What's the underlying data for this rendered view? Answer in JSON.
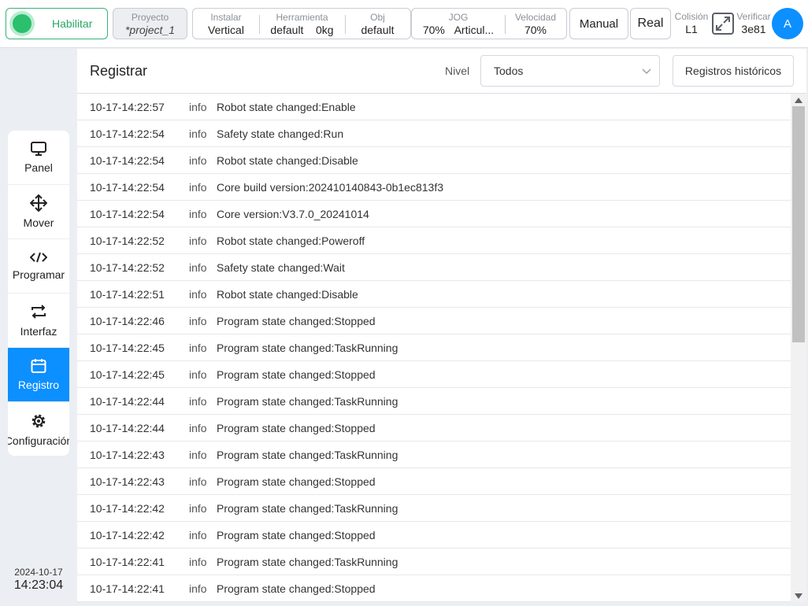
{
  "topbar": {
    "enable_label": "Habilitar",
    "project": {
      "caption": "Proyecto",
      "value": "*project_1"
    },
    "install": {
      "caption": "Instalar",
      "value": "Vertical"
    },
    "tool": {
      "caption": "Herramienta",
      "value": "default",
      "weight": "0kg"
    },
    "obj": {
      "caption": "Obj",
      "value": "default"
    },
    "jog": {
      "caption": "JOG",
      "value": "70%",
      "mode": "Articul..."
    },
    "speed": {
      "caption": "Velocidad",
      "value": "70%"
    },
    "manual_label": "Manual",
    "real_label": "Real",
    "collision": {
      "caption": "Colisión",
      "value": "L1"
    },
    "verify": {
      "caption": "Verificar",
      "value": "3e81"
    },
    "avatar_letter": "A"
  },
  "sidebar": {
    "items": [
      {
        "label": "Panel",
        "icon": "monitor-icon"
      },
      {
        "label": "Mover",
        "icon": "move-arrows-icon"
      },
      {
        "label": "Programar",
        "icon": "code-icon"
      },
      {
        "label": "Interfaz",
        "icon": "swap-icon"
      },
      {
        "label": "Registro",
        "icon": "calendar-icon",
        "active": true
      },
      {
        "label": "Configuración",
        "icon": "gear-icon"
      }
    ],
    "date": "2024-10-17",
    "time": "14:23:04"
  },
  "panel": {
    "title": "Registrar",
    "level_label": "Nivel",
    "level_value": "Todos",
    "history_button": "Registros históricos"
  },
  "log": {
    "rows": [
      {
        "time": "10-17-14:22:57",
        "level": "info",
        "message": "Robot state changed:Enable"
      },
      {
        "time": "10-17-14:22:54",
        "level": "info",
        "message": "Safety state changed:Run"
      },
      {
        "time": "10-17-14:22:54",
        "level": "info",
        "message": "Robot state changed:Disable"
      },
      {
        "time": "10-17-14:22:54",
        "level": "info",
        "message": "Core build version:202410140843-0b1ec813f3"
      },
      {
        "time": "10-17-14:22:54",
        "level": "info",
        "message": "Core version:V3.7.0_20241014"
      },
      {
        "time": "10-17-14:22:52",
        "level": "info",
        "message": "Robot state changed:Poweroff"
      },
      {
        "time": "10-17-14:22:52",
        "level": "info",
        "message": "Safety state changed:Wait"
      },
      {
        "time": "10-17-14:22:51",
        "level": "info",
        "message": "Robot state changed:Disable"
      },
      {
        "time": "10-17-14:22:46",
        "level": "info",
        "message": "Program state changed:Stopped"
      },
      {
        "time": "10-17-14:22:45",
        "level": "info",
        "message": "Program state changed:TaskRunning"
      },
      {
        "time": "10-17-14:22:45",
        "level": "info",
        "message": "Program state changed:Stopped"
      },
      {
        "time": "10-17-14:22:44",
        "level": "info",
        "message": "Program state changed:TaskRunning"
      },
      {
        "time": "10-17-14:22:44",
        "level": "info",
        "message": "Program state changed:Stopped"
      },
      {
        "time": "10-17-14:22:43",
        "level": "info",
        "message": "Program state changed:TaskRunning"
      },
      {
        "time": "10-17-14:22:43",
        "level": "info",
        "message": "Program state changed:Stopped"
      },
      {
        "time": "10-17-14:22:42",
        "level": "info",
        "message": "Program state changed:TaskRunning"
      },
      {
        "time": "10-17-14:22:42",
        "level": "info",
        "message": "Program state changed:Stopped"
      },
      {
        "time": "10-17-14:22:41",
        "level": "info",
        "message": "Program state changed:TaskRunning"
      },
      {
        "time": "10-17-14:22:41",
        "level": "info",
        "message": "Program state changed:Stopped"
      }
    ]
  },
  "colors": {
    "accent": "#0c8fff",
    "enable_green": "#2bbf6e"
  }
}
